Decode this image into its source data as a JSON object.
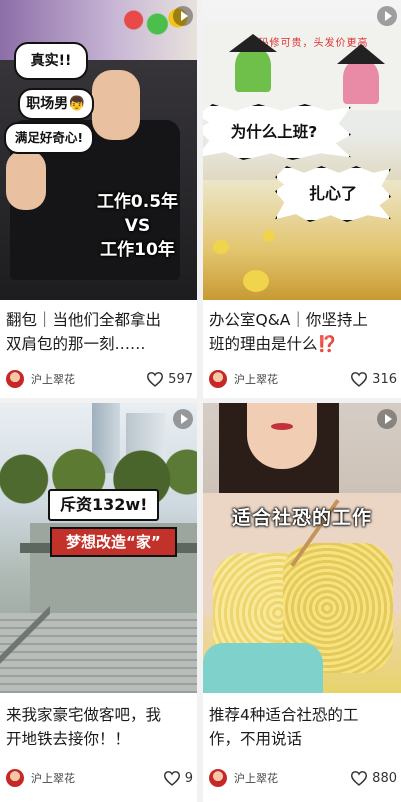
{
  "cards": [
    {
      "thumb": {
        "tag1": "真实!!",
        "tag2": "职场男👦",
        "tag3": "满足好奇心!",
        "big_line1": "工作0.5年",
        "big_line2": "VS",
        "big_line3": "工作10年"
      },
      "title_line1": "翻包｜当他们全都拿出",
      "title_line2": "双肩包的那一刻……",
      "author": "沪上翠花",
      "likes": "597"
    },
    {
      "thumb": {
        "banner": "代码修可贵，头发价更高",
        "question": "为什么上班?",
        "answer": "扎心了"
      },
      "title_line1": "办公室Q&A｜你坚持上",
      "title_line2": "班的理由是什么⁉️",
      "author": "沪上翠花",
      "likes": "316"
    },
    {
      "thumb": {
        "label1": "斥资132w!",
        "label2": "梦想改造“家”"
      },
      "title_line1": "来我家豪宅做客吧，我",
      "title_line2": "开地铁去接你！！",
      "author": "沪上翠花",
      "likes": "9"
    },
    {
      "thumb": {
        "big": "适合社恐的工作"
      },
      "title_line1": "推荐4种适合社恐的工",
      "title_line2": "作，不用说话",
      "author": "沪上翠花",
      "likes": "880"
    }
  ],
  "colors": {
    "background": "#f2f2f2",
    "card": "#ffffff",
    "accent_red": "#c3312b"
  },
  "icons": {
    "like": "heart-outline-icon",
    "play": "play-icon"
  }
}
